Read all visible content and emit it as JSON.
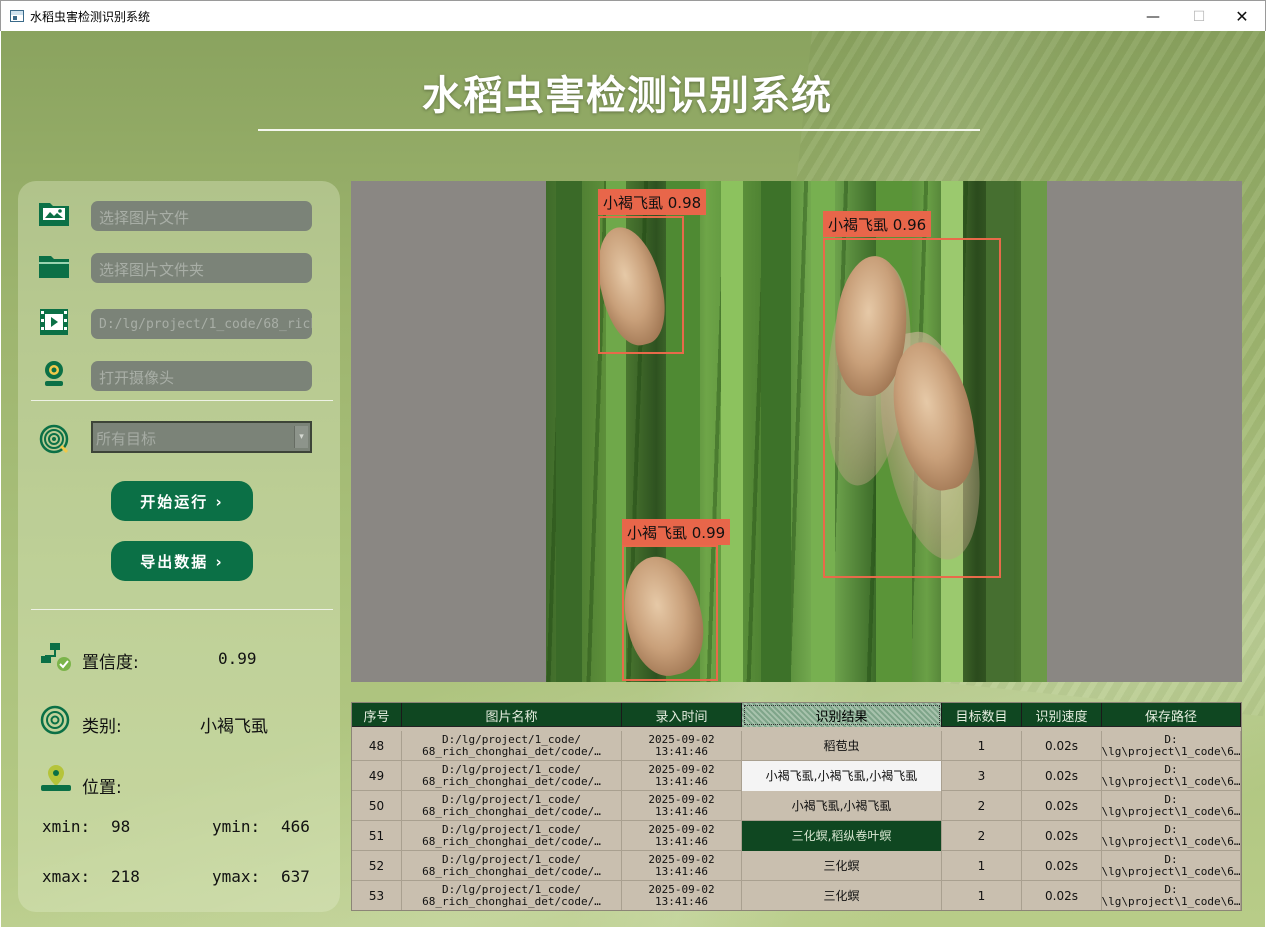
{
  "window": {
    "title": "水稻虫害检测识别系统",
    "minimize": "—",
    "maximize": "☐",
    "close": "✕"
  },
  "header": {
    "title": "水稻虫害检测识别系统"
  },
  "inputs": {
    "image_file": "选择图片文件",
    "image_folder": "选择图片文件夹",
    "video_path": "D:/lg/project/1_code/68_rich_chonghai_det",
    "camera": "打开摄像头"
  },
  "target_select": {
    "selected": "所有目标",
    "arrow": "▾"
  },
  "buttons": {
    "start": "开始运行 ›",
    "export": "导出数据 ›"
  },
  "info": {
    "confidence_label": "置信度:",
    "confidence_value": "0.99",
    "class_label": "类别:",
    "class_value": "小褐飞虱",
    "position_label": "位置:",
    "xmin_label": "xmin:",
    "xmin_value": "98",
    "ymin_label": "ymin:",
    "ymin_value": "466",
    "xmax_label": "xmax:",
    "xmax_value": "218",
    "ymax_label": "ymax:",
    "ymax_value": "637"
  },
  "detections": [
    {
      "label": "小褐飞虱 0.98"
    },
    {
      "label": "小褐飞虱 0.96"
    },
    {
      "label": "小褐飞虱 0.99"
    }
  ],
  "table": {
    "headers": [
      "序号",
      "图片名称",
      "录入时间",
      "识别结果",
      "目标数目",
      "识别速度",
      "保存路径"
    ],
    "rows": [
      {
        "id": "48",
        "name": "D:/lg/project/1_code/\n68_rich_chonghai_det/code/…",
        "time": "2025-09-02\n13:41:46",
        "result": "稻苞虫",
        "count": "1",
        "speed": "0.02s",
        "path": "D:\n\\lg\\project\\1_code\\6…"
      },
      {
        "id": "49",
        "name": "D:/lg/project/1_code/\n68_rich_chonghai_det/code/…",
        "time": "2025-09-02\n13:41:46",
        "result": "小褐飞虱,小褐飞虱,小褐飞虱",
        "count": "3",
        "speed": "0.02s",
        "path": "D:\n\\lg\\project\\1_code\\6…"
      },
      {
        "id": "50",
        "name": "D:/lg/project/1_code/\n68_rich_chonghai_det/code/…",
        "time": "2025-09-02\n13:41:46",
        "result": "小褐飞虱,小褐飞虱",
        "count": "2",
        "speed": "0.02s",
        "path": "D:\n\\lg\\project\\1_code\\6…"
      },
      {
        "id": "51",
        "name": "D:/lg/project/1_code/\n68_rich_chonghai_det/code/…",
        "time": "2025-09-02\n13:41:46",
        "result": "三化螟,稻纵卷叶螟",
        "count": "2",
        "speed": "0.02s",
        "path": "D:\n\\lg\\project\\1_code\\6…"
      },
      {
        "id": "52",
        "name": "D:/lg/project/1_code/\n68_rich_chonghai_det/code/…",
        "time": "2025-09-02\n13:41:46",
        "result": "三化螟",
        "count": "1",
        "speed": "0.02s",
        "path": "D:\n\\lg\\project\\1_code\\6…"
      },
      {
        "id": "53",
        "name": "D:/lg/project/1_code/\n68_rich_chonghai_det/code/…",
        "time": "2025-09-02\n13:41:46",
        "result": "三化螟",
        "count": "1",
        "speed": "0.02s",
        "path": "D:\n\\lg\\project\\1_code\\6…"
      }
    ]
  },
  "colors": {
    "accent_green": "#0b7046",
    "header_dark_green": "#0f4721",
    "detection_box": "#e86a4a"
  }
}
